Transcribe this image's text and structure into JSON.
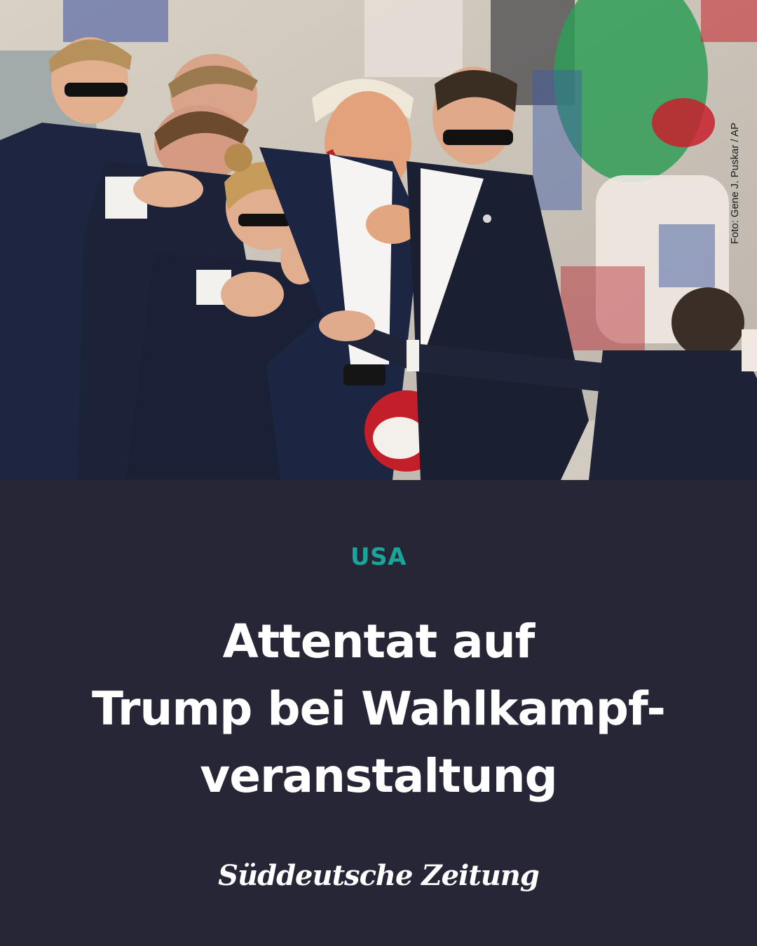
{
  "photo": {
    "credit": "Foto: Gene J. Puskar / AP"
  },
  "article": {
    "kicker": "USA",
    "headline_lines": [
      "Attentat auf",
      "Trump bei Wahlkampf-",
      "veranstaltung"
    ]
  },
  "brand": {
    "name": "Süddeutsche Zeitung"
  },
  "colors": {
    "background": "#262637",
    "kicker": "#1aa59a",
    "text": "#ffffff"
  }
}
